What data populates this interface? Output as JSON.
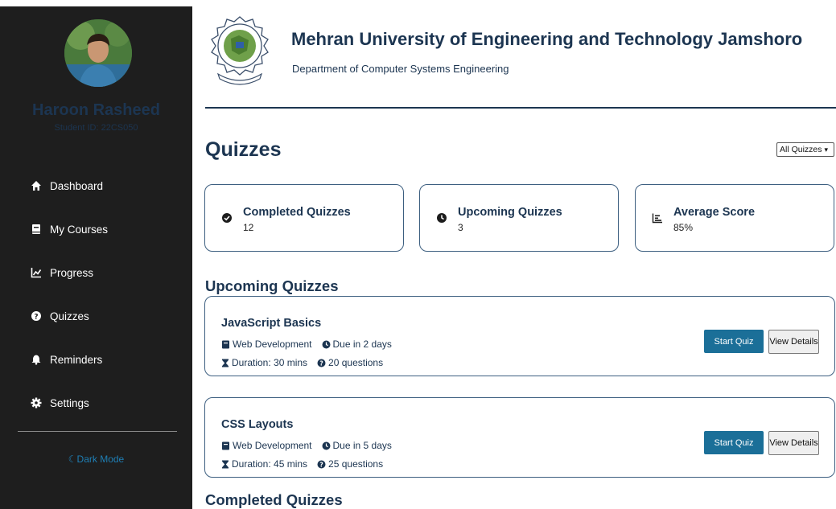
{
  "profile": {
    "name": "Haroon Rasheed",
    "student_id": "Student ID: 22CS050"
  },
  "sidebar": {
    "items": [
      {
        "label": "Dashboard",
        "icon": "home-icon"
      },
      {
        "label": "My Courses",
        "icon": "book-icon"
      },
      {
        "label": "Progress",
        "icon": "chart-line-icon"
      },
      {
        "label": "Quizzes",
        "icon": "question-circle-icon"
      },
      {
        "label": "Reminders",
        "icon": "bell-icon"
      },
      {
        "label": "Settings",
        "icon": "gear-icon"
      }
    ],
    "dark_mode_label": "Dark Mode"
  },
  "header": {
    "university": "Mehran University of Engineering and Technology Jamshoro",
    "department": "Department of Computer Systems Engineering"
  },
  "page": {
    "title": "Quizzes",
    "filter_value": "All Quizzes"
  },
  "stats": [
    {
      "title": "Completed Quizzes",
      "value": "12",
      "icon": "check-circle-icon"
    },
    {
      "title": "Upcoming Quizzes",
      "value": "3",
      "icon": "clock-icon"
    },
    {
      "title": "Average Score",
      "value": "85%",
      "icon": "bar-chart-icon"
    }
  ],
  "upcoming": {
    "heading": "Upcoming Quizzes",
    "quizzes": [
      {
        "title": "JavaScript Basics",
        "course": "Web Development",
        "due": "Due in 2 days",
        "duration": "Duration: 30 mins",
        "questions": "20 questions",
        "start_label": "Start Quiz",
        "details_label": "View Details"
      },
      {
        "title": "CSS Layouts",
        "course": "Web Development",
        "due": "Due in 5 days",
        "duration": "Duration: 45 mins",
        "questions": "25 questions",
        "start_label": "Start Quiz",
        "details_label": "View Details"
      }
    ]
  },
  "completed": {
    "heading": "Completed Quizzes"
  },
  "colors": {
    "sidebar_bg": "#1e1e1e",
    "primary": "#1c3551",
    "button": "#1b6f98",
    "accent_link": "#1e7fb5"
  }
}
